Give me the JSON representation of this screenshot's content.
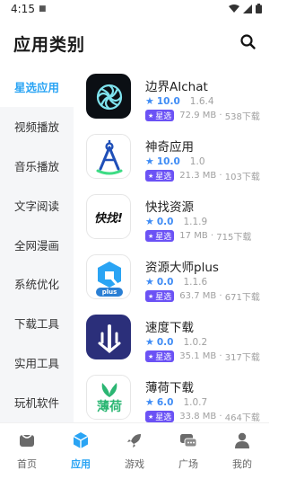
{
  "status_bar": {
    "time": "4:15"
  },
  "header": {
    "title": "应用类别"
  },
  "sidebar": {
    "items": [
      {
        "label": "星选应用"
      },
      {
        "label": "视频播放"
      },
      {
        "label": "音乐播放"
      },
      {
        "label": "文字阅读"
      },
      {
        "label": "全网漫画"
      },
      {
        "label": "系统优化"
      },
      {
        "label": "下载工具"
      },
      {
        "label": "实用工具"
      },
      {
        "label": "玩机软件"
      }
    ]
  },
  "apps": [
    {
      "name": "边界AIchat",
      "score": "10.0",
      "version": "1.6.4",
      "badge": "星选",
      "size": "72.9 MB",
      "downloads": "538下载"
    },
    {
      "name": "神奇应用",
      "score": "10.0",
      "version": "1.0",
      "badge": "星选",
      "size": "21.3 MB",
      "downloads": "103下载"
    },
    {
      "name": "快找资源",
      "score": "0.0",
      "version": "1.1.9",
      "badge": "星选",
      "size": "17 MB",
      "downloads": "715下载",
      "icon_text": "快找!"
    },
    {
      "name": "资源大师plus",
      "score": "0.0",
      "version": "1.1.6",
      "badge": "星选",
      "size": "63.7 MB",
      "downloads": "671下载",
      "icon_text": "plus"
    },
    {
      "name": "速度下载",
      "score": "0.0",
      "version": "1.0.2",
      "badge": "星选",
      "size": "35.1 MB",
      "downloads": "317下载"
    },
    {
      "name": "薄荷下载",
      "score": "6.0",
      "version": "1.0.7",
      "badge": "星选",
      "size": "33.8 MB",
      "downloads": "464下载",
      "icon_text": "薄荷"
    }
  ],
  "bottom_nav": {
    "items": [
      {
        "label": "首页",
        "icon": "home-icon"
      },
      {
        "label": "应用",
        "icon": "cube-icon"
      },
      {
        "label": "游戏",
        "icon": "rocket-icon"
      },
      {
        "label": "广场",
        "icon": "chat-icon"
      },
      {
        "label": "我的",
        "icon": "person-icon"
      }
    ]
  },
  "colors": {
    "accent": "#2aa4f4",
    "rating": "#3f8cf5",
    "badge": "#6b52f5",
    "sidebar_bg": "#f5f6f8"
  }
}
